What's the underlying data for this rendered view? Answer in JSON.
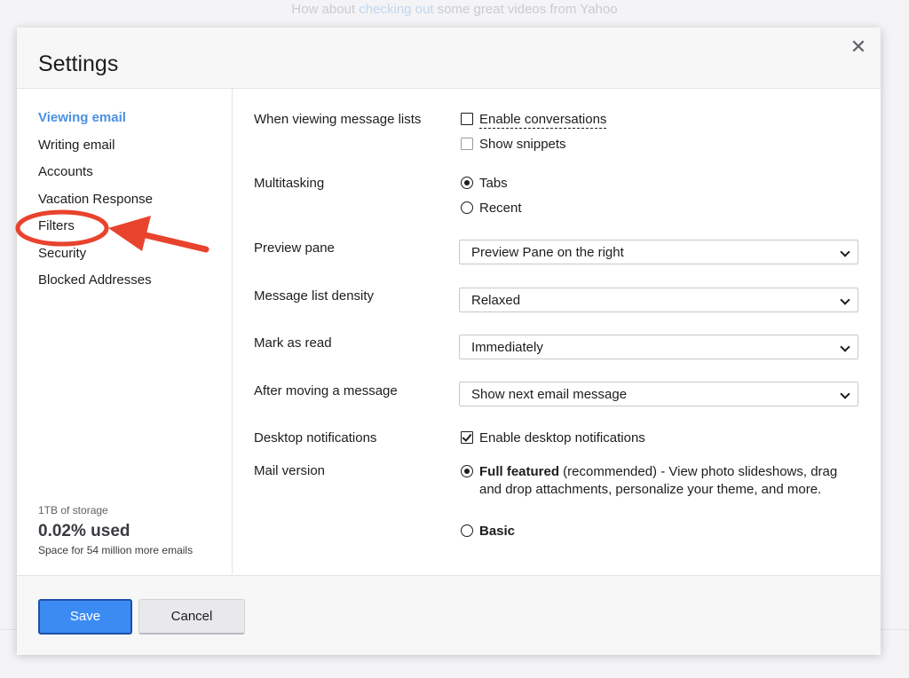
{
  "backdrop": {
    "text_before": "How about ",
    "link_text": "checking out",
    "text_after": " some great videos from Yahoo"
  },
  "dialog": {
    "title": "Settings",
    "close_icon": "close-icon",
    "close_glyph": "✕"
  },
  "sidebar": {
    "items": [
      {
        "label": "Viewing email",
        "active": true
      },
      {
        "label": "Writing email"
      },
      {
        "label": "Accounts"
      },
      {
        "label": "Vacation Response"
      },
      {
        "label": "Filters"
      },
      {
        "label": "Security"
      },
      {
        "label": "Blocked Addresses"
      }
    ],
    "storage": {
      "capacity": "1TB of storage",
      "used": "0.02% used",
      "remaining": "Space for 54 million more emails"
    }
  },
  "settings": {
    "viewing_lists": {
      "label": "When viewing message lists",
      "enable_conversations": {
        "label": "Enable conversations",
        "checked": false
      },
      "show_snippets": {
        "label": "Show snippets",
        "checked": false
      }
    },
    "multitasking": {
      "label": "Multitasking",
      "options": [
        {
          "label": "Tabs",
          "selected": true
        },
        {
          "label": "Recent",
          "selected": false
        }
      ]
    },
    "preview_pane": {
      "label": "Preview pane",
      "value": "Preview Pane on the right"
    },
    "density": {
      "label": "Message list density",
      "value": "Relaxed"
    },
    "mark_as_read": {
      "label": "Mark as read",
      "value": "Immediately"
    },
    "after_moving": {
      "label": "After moving a message",
      "value": "Show next email message"
    },
    "desktop_notifications": {
      "label": "Desktop notifications",
      "option": {
        "label": "Enable desktop notifications",
        "checked": true
      }
    },
    "mail_version": {
      "label": "Mail version",
      "full": {
        "title": "Full featured",
        "description": " (recommended) - View photo slideshows, drag and drop attachments, personalize your theme, and more.",
        "selected": true
      },
      "basic": {
        "title": "Basic",
        "selected": false
      }
    }
  },
  "footer": {
    "save_label": "Save",
    "cancel_label": "Cancel"
  },
  "annotation": {
    "highlight_color": "#e8432d",
    "target": "Filters"
  },
  "colors": {
    "accent": "#4a90e2",
    "primary_button": "#3c8bf3",
    "annotation_red": "#e8432d"
  }
}
